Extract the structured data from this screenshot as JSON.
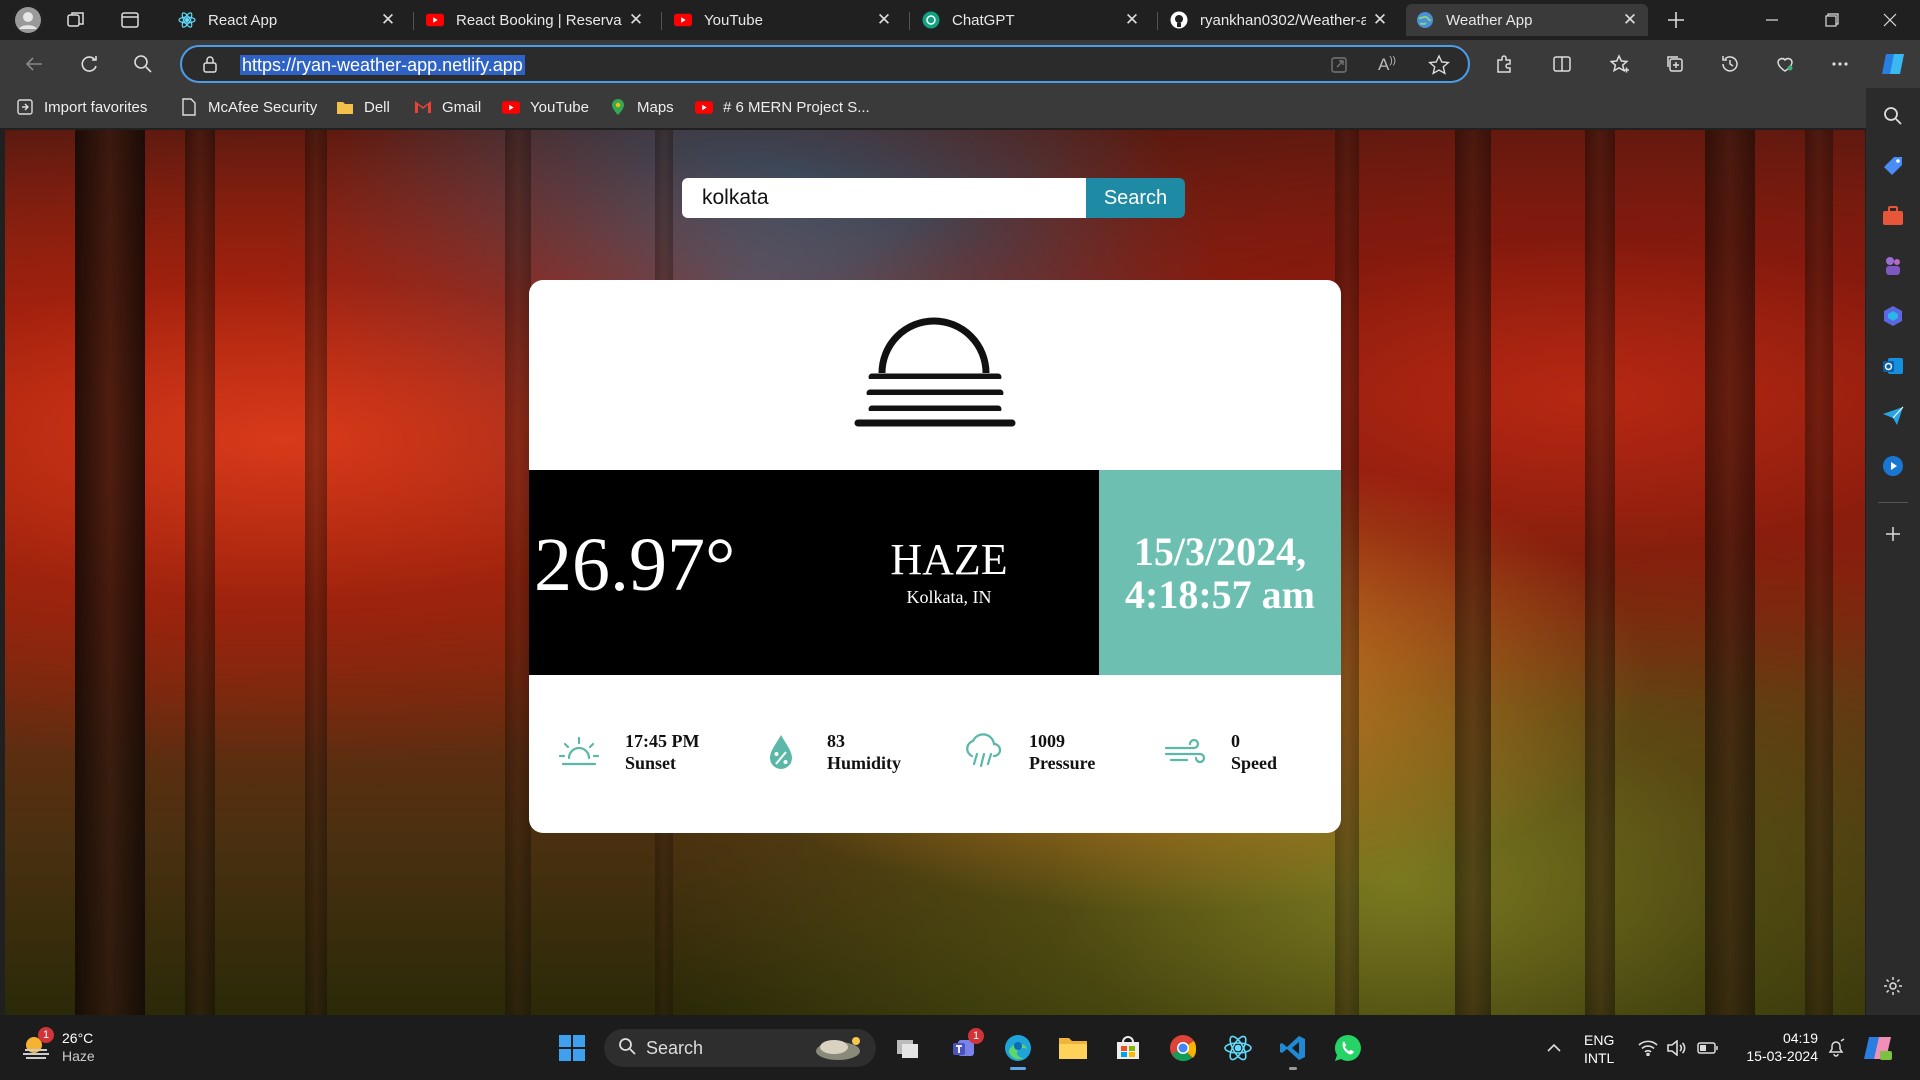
{
  "tabs": [
    {
      "title": "React App",
      "favicon": "react-logo"
    },
    {
      "title": "React Booking | Reservati",
      "favicon": "youtube-logo"
    },
    {
      "title": "YouTube",
      "favicon": "youtube-logo"
    },
    {
      "title": "ChatGPT",
      "favicon": "chatgpt-logo"
    },
    {
      "title": "ryankhan0302/Weather-a",
      "favicon": "github-logo"
    },
    {
      "title": "Weather App",
      "favicon": "globe-icon",
      "active": true
    }
  ],
  "address": {
    "url": "https://ryan-weather-app.netlify.app"
  },
  "favorites": [
    {
      "label": "Import favorites",
      "icon": "import-icon"
    },
    {
      "label": "McAfee Security",
      "icon": "page-icon"
    },
    {
      "label": "Dell",
      "icon": "folder-icon"
    },
    {
      "label": "Gmail",
      "icon": "gmail-logo"
    },
    {
      "label": "YouTube",
      "icon": "youtube-logo"
    },
    {
      "label": "Maps",
      "icon": "maps-pin"
    },
    {
      "label": "# 6 MERN Project S...",
      "icon": "youtube-logo"
    }
  ],
  "app": {
    "search": {
      "value": "kolkata",
      "button": "Search"
    },
    "weather": {
      "icon": "haze-icon",
      "temperature": "26.97°",
      "condition": "HAZE",
      "location": "Kolkata, IN",
      "date": "15/3/2024,",
      "time": "4:18:57 am"
    },
    "stats": [
      {
        "icon": "sunset-icon",
        "value": "17:45 PM",
        "label": "Sunset"
      },
      {
        "icon": "humidity-icon",
        "value": "83",
        "label": "Humidity"
      },
      {
        "icon": "pressure-icon",
        "value": "1009",
        "label": "Pressure"
      },
      {
        "icon": "wind-icon",
        "value": "0",
        "label": "Speed"
      }
    ]
  },
  "taskbar": {
    "weather_temp": "26°C",
    "weather_desc": "Haze",
    "weather_badge": "1",
    "search_label": "Search",
    "teams_badge": "1",
    "lang1": "ENG",
    "lang2": "INTL",
    "clock_time": "04:19",
    "clock_date": "15-03-2024"
  },
  "colors": {
    "accent_teal": "#6cbfb1",
    "search_button": "#1f8aa3",
    "address_focus": "#4c9ee8"
  }
}
